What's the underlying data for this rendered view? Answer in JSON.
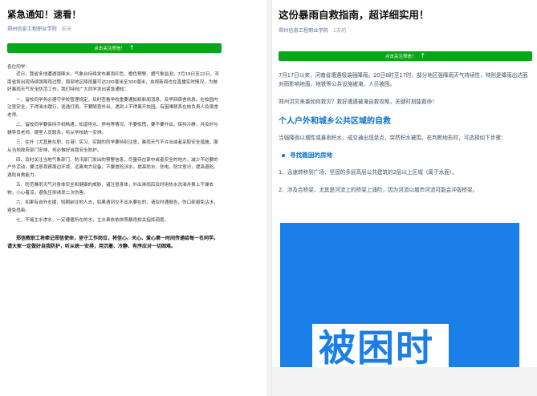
{
  "left_article": {
    "title": "紧急通知！速看！",
    "author": "郑州信息工程职业学院",
    "date": "前天",
    "follow_label": "点击关注郑信！",
    "follow_arrow": "↑",
    "greeting": "各位同学：",
    "paragraphs": [
      "近日，我省多地遭遇强降水，气象台持续发布暴雨红色、橙色预警。据气象监测，7月19日至22日，河南省将出现持续强降雨过程，局部地区降雨量可达200毫米至300毫米，央视新闻也在直播实时情况。为做好暴雨天气安全防范工作，我们特向广大同学发出紧急通知：",
      "一、留校同学务必遵守学校管理规定，及时查看学校重要通知和新闻消息，及早回宿舍休息。在校园内注意安全，不得淌水蹚行，逃逸打闹。不要随意外出，遇到上不得离开校园。有困难联系在校负责人及宿舍老师。",
      "二、留校同学要保持手机畅通，知道停水、停电等情况，不要惊慌，要不要外出，保持冷静，并及时与辅导员老师、寝室人员联系，听从学校统一安排。",
      "三、在外（尤其是在职、在港）实习、实践的同学要特别注意，暴雨天气不许出或者采取安全措施，服从当地政府部门安排，务必做好自我安全防护。",
      "四、及时关注当地气象部门、防汛部门发出的预警信息，尽量待在家中或者安全的地方，减少不必要的户外活动，要注意观察周边环境，远离电力设备，不要冒险涉水，提高防水、防电、防灾意识，提高避险、遇险自救能力。",
      "五、防范暴雨天气对身体安全和健康的威胁，诸注意身体，外出淋雨后及时用热水洗澡并换上干燥衣物，小心着凉，避免压抑诱发二次伤害。",
      "六、如果有自外支援，短期前往他人去，如果遇到交不出水要在的，请及时通报告，伤口部避免沾水，避免感染。",
      "七、不堵主水渗水，一定遵循所在的水，主水具依依依照暴雨相关指挥调度。"
    ],
    "closing": "郑信教职工将牵记郑信使命，坚守工作岗位，将信心、关心、爱心第一时间传递给每一名同学。请大家一定做好自我防护，听从统一安排，用沉着、冷静、有序应对一切困难。"
  },
  "right_article": {
    "title": "这份暴雨自救指南，超详细实用！",
    "author": "郑州信息工程职业学院",
    "date": "1天前",
    "follow_label": "点击关注郑信！",
    "follow_arrow": "↑",
    "intro": "7月17日以来，河南省遭遇极端强降雨。20日8时至17时，部分地区强降雨天气持续性，特别是降雨出达面对雨影响地面，地铁等公共设施被淹，人员被困。",
    "intro2": "郑州洪灾来袭如何救灾？救好遭遇被淹自救攻略，关键时刻能救命！",
    "h2": "个人户外和城乡公共区域的自救",
    "para": "当强降雨以城性或暴雨积水，成交通出现单点，突然积水被围，在判断地形时，可选择如下步骤：",
    "h3": "寻找稳固的房地",
    "item1": "1、迅速转移到广场、坚固的多层高层公共建筑的2层以上区域（离于水面）。",
    "item2": "2、涉及合桥梁，尤其是河流上的桥梁上涌险，因为河流以城市河流可能会冲毁桥梁。",
    "hero_text": "被困时",
    "hero_color": "#1a7fe8"
  }
}
